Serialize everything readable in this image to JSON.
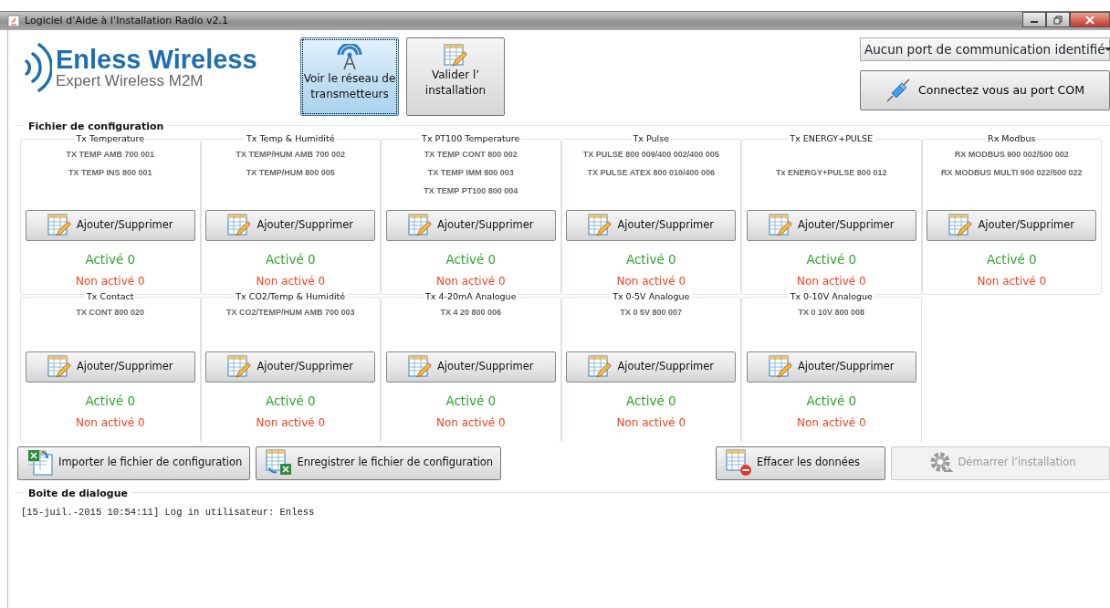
{
  "window": {
    "title": "Logiciel d’Aide à l’Installation Radio v2.1"
  },
  "logo": {
    "name": "Enless Wireless",
    "tagline": "Expert Wireless M2M"
  },
  "toolbar_buttons": [
    {
      "label": "Voir le réseau de transmetteurs",
      "kind": "network",
      "selected": true
    },
    {
      "label": "Valider l’ installation",
      "kind": "validate",
      "selected": false
    }
  ],
  "port_select": {
    "value": "Aucun port de communication identifié"
  },
  "connect_button": {
    "label": "Connectez vous au port COM"
  },
  "config": {
    "title": "Fichier de configuration",
    "groups": [
      {
        "title": "Tx Temperature",
        "models": [
          "TX TEMP AMB 700 001",
          "TX TEMP INS 800 001"
        ],
        "button": "Ajouter/Supprimer",
        "active": "Activé 0",
        "inactive": "Non activé 0"
      },
      {
        "title": "Tx Temp & Humidité",
        "models": [
          "TX TEMP/HUM AMB 700 002",
          "TX TEMP/HUM 800 005"
        ],
        "button": "Ajouter/Supprimer",
        "active": "Activé 0",
        "inactive": "Non activé 0"
      },
      {
        "title": "Tx PT100 Temperature",
        "models": [
          "TX TEMP CONT 800 002",
          "TX TEMP IMM 800 003",
          "TX TEMP PT100 800 004"
        ],
        "button": "Ajouter/Supprimer",
        "active": "Activé 0",
        "inactive": "Non activé 0"
      },
      {
        "title": "Tx Pulse",
        "models": [
          "TX PULSE 800 009/400 002/400 005",
          "TX PULSE ATEX 800 010/400 006"
        ],
        "button": "Ajouter/Supprimer",
        "active": "Activé 0",
        "inactive": "Non activé 0"
      },
      {
        "title": "Tx ENERGY+PULSE",
        "blank_first_line": true,
        "models": [
          "Tx ENERGY+PULSE 800 012"
        ],
        "button": "Ajouter/Supprimer",
        "active": "Activé 0",
        "inactive": "Non activé 0"
      },
      {
        "title": "Rx Modbus",
        "models": [
          "RX MODBUS 900 002/500 002",
          "RX MODBUS MULTI 900 022/500 022"
        ],
        "button": "Ajouter/Supprimer",
        "active": "Activé 0",
        "inactive": "Non activé 0"
      },
      {
        "title": "Tx Contact",
        "models": [
          "TX CONT 800 020"
        ],
        "button": "Ajouter/Supprimer",
        "active": "Activé 0",
        "inactive": "Non activé 0"
      },
      {
        "title": "Tx CO2/Temp & Humidité",
        "models": [
          "TX CO2/TEMP/HUM AMB 700 003"
        ],
        "button": "Ajouter/Supprimer",
        "active": "Activé 0",
        "inactive": "Non activé 0"
      },
      {
        "title": "Tx 4-20mA Analogue",
        "models": [
          "TX 4 20 800 006"
        ],
        "button": "Ajouter/Supprimer",
        "active": "Activé 0",
        "inactive": "Non activé 0"
      },
      {
        "title": "Tx 0-5V Analogue",
        "models": [
          "TX 0 5V 800 007"
        ],
        "button": "Ajouter/Supprimer",
        "active": "Activé 0",
        "inactive": "Non activé 0"
      },
      {
        "title": "Tx 0-10V Analogue",
        "models": [
          "TX 0 10V 800 008"
        ],
        "button": "Ajouter/Supprimer",
        "active": "Activé 0",
        "inactive": "Non activé 0"
      }
    ]
  },
  "actions": [
    {
      "label": "Importer le fichier de configuration",
      "kind": "import",
      "disabled": false
    },
    {
      "label": "Enregistrer le fichier de configuration",
      "kind": "save",
      "disabled": false
    },
    {
      "label": "Effacer les données",
      "kind": "clear",
      "disabled": false
    },
    {
      "label": "Démarrer l’installation",
      "kind": "start",
      "disabled": true
    }
  ],
  "dialog": {
    "title": "Boite de dialogue",
    "lines": [
      "[15-juil.-2015 10:54:11] Log in utilisateur: Enless"
    ]
  }
}
